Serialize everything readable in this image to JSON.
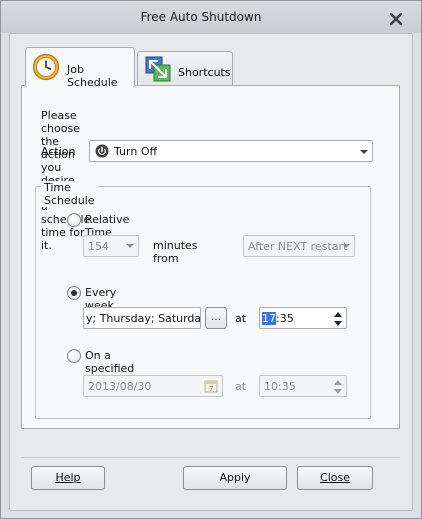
{
  "window": {
    "title": "Free Auto Shutdown"
  },
  "tabs": [
    {
      "label": "Job Schedule",
      "icon": "clock-icon",
      "active": true
    },
    {
      "label": "Shortcuts",
      "icon": "shortcut-icon",
      "active": false
    }
  ],
  "job": {
    "instruction": "Please choose the action you desire, then set a schedule time for it.",
    "action_label": "Action",
    "action_value": "Turn Off",
    "group_title": "Time Schedule",
    "relative": {
      "label": "Relative Time",
      "minutes_value": "154",
      "minutes_from_label": "minutes from",
      "from_value": "After NEXT restart",
      "selected": false
    },
    "weekly": {
      "label": "Every week on",
      "days_value": "y; Thursday; Saturday;",
      "browse_label": "...",
      "at_label": "at",
      "time_hour": "17",
      "time_rest": ":35",
      "selected": true
    },
    "specified": {
      "label": "On a specified date",
      "date_value": "2013/08/30",
      "at_label": "at",
      "time_value": "10:35",
      "selected": false
    }
  },
  "buttons": {
    "help": "Help",
    "apply": "Apply",
    "close": "Close"
  },
  "colors": {
    "accent": "#3a74d6",
    "window_bg": "#dde0e3",
    "panel_bg": "#f7f8f9"
  }
}
